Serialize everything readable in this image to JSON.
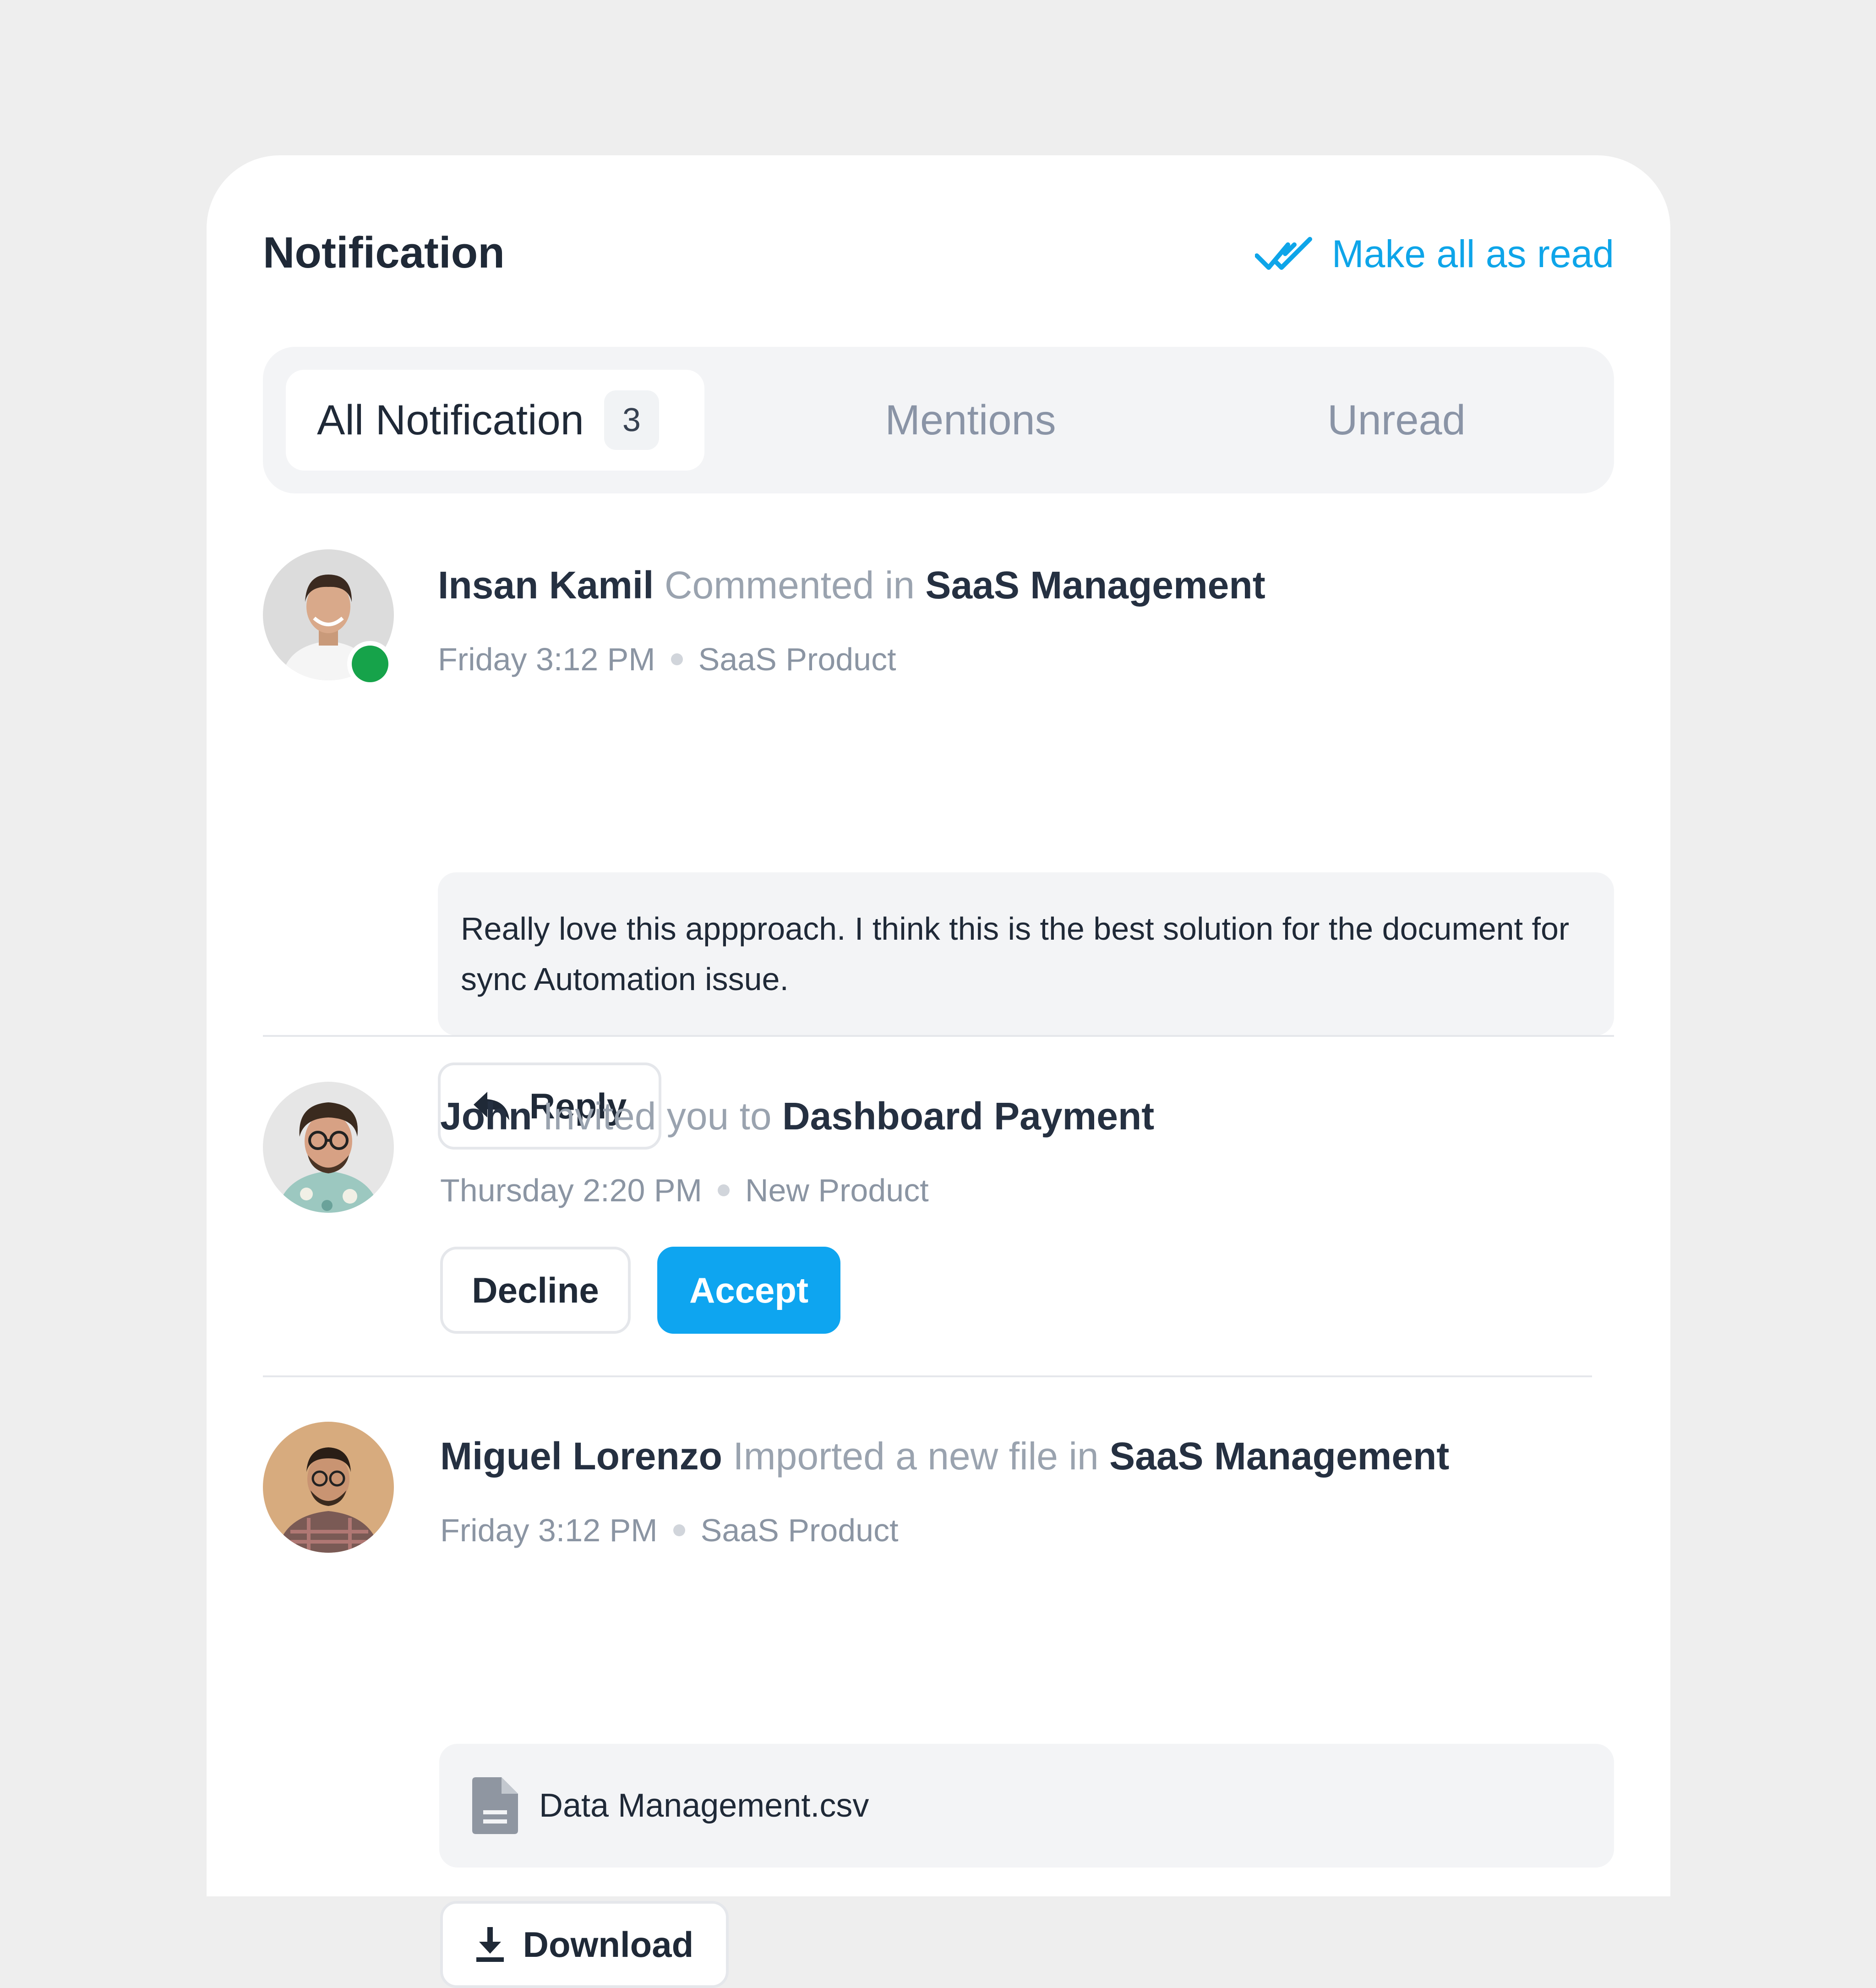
{
  "header": {
    "title": "Notification",
    "mark_all_label": "Make all as read",
    "mark_all_icon": "double-check-icon"
  },
  "tabs": [
    {
      "label": "All Notification",
      "count": "3",
      "active": true
    },
    {
      "label": "Mentions",
      "active": false
    },
    {
      "label": "Unread",
      "active": false
    }
  ],
  "notifications": [
    {
      "user": "Insan Kamil",
      "action": "Commented in",
      "target": "SaaS Management",
      "time": "Friday 3:12 PM",
      "project": "SaaS Product",
      "online": true,
      "comment": "Really love this appproach. I think this is the best solution for the document for sync Automation issue.",
      "reply_label": "Reply"
    },
    {
      "user": "John",
      "action": "Invited you to",
      "target": "Dashboard Payment",
      "time": "Thursday 2:20 PM",
      "project": "New Product",
      "decline_label": "Decline",
      "accept_label": "Accept"
    },
    {
      "user": "Miguel Lorenzo",
      "action": "Imported a new file in",
      "target": "SaaS Management",
      "time": "Friday 3:12 PM",
      "project": "SaaS Product",
      "file_name": "Data Management.csv",
      "download_label": "Download"
    }
  ],
  "colors": {
    "accent": "#0ea5e9",
    "online": "#16a34a",
    "text_dark": "#1f2937",
    "text_muted": "#9aa3af",
    "background": "#eeeeee"
  }
}
